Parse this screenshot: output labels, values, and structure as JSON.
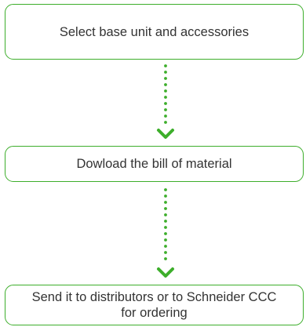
{
  "flow": {
    "steps": [
      {
        "label": "Select base unit and accessories"
      },
      {
        "label": "Dowload the bill of material"
      },
      {
        "label": "Send it to distributors or to Schneider CCC for ordering"
      }
    ]
  },
  "colors": {
    "accent": "#3dae2b",
    "text": "#333333",
    "background": "#ffffff"
  },
  "icons": {
    "arrow_head": "chevron-down-icon"
  }
}
